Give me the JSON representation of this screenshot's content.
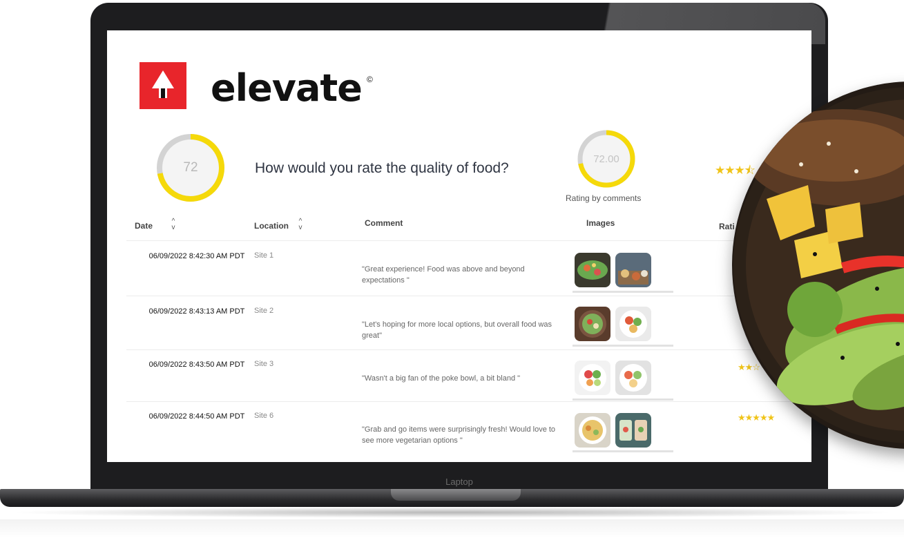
{
  "laptop_label": "Laptop",
  "brand": {
    "name": "elevate",
    "mark": "©"
  },
  "summary": {
    "score": "72",
    "question": "How would you rate the quality of food?",
    "rating_value": "72.00",
    "rating_caption": "Rating by comments",
    "stars": "★★★⯪"
  },
  "table": {
    "headers": {
      "date": "Date",
      "location": "Location",
      "comment": "Comment",
      "images": "Images",
      "rating": "Rati"
    },
    "rows": [
      {
        "date": "06/09/2022 8:42:30 AM PDT",
        "location": "Site 1",
        "comment": "\"Great experience! Food was above and beyond expectations \"",
        "images": [
          "salad-platter",
          "restaurant-spread"
        ],
        "stars": ""
      },
      {
        "date": "06/09/2022 8:43:13 AM PDT",
        "location": "Site 2",
        "comment": "\"Let's hoping for more local options, but overall food was great\"",
        "images": [
          "green-salad-bowl",
          "poke-bowl"
        ],
        "stars": ""
      },
      {
        "date": "06/09/2022 8:43:50 AM PDT",
        "location": "Site 3",
        "comment": "\"Wasn't a big fan of the poke bowl, a bit bland \"",
        "images": [
          "poke-bowl-salmon",
          "poke-bowl-veggie"
        ],
        "stars": "★★☆"
      },
      {
        "date": "06/09/2022 8:44:50 AM PDT",
        "location": "Site 6",
        "comment": "\"Grab and go items were surprisingly fresh! Would love to see more vegetarian options \"",
        "images": [
          "rice-dish",
          "spring-rolls"
        ],
        "stars": "★★★★★"
      }
    ]
  },
  "colors": {
    "brand_red": "#e8252b",
    "gauge_yellow": "#f5d90a",
    "gauge_track": "#d3d3d3",
    "star": "#f0c419"
  }
}
